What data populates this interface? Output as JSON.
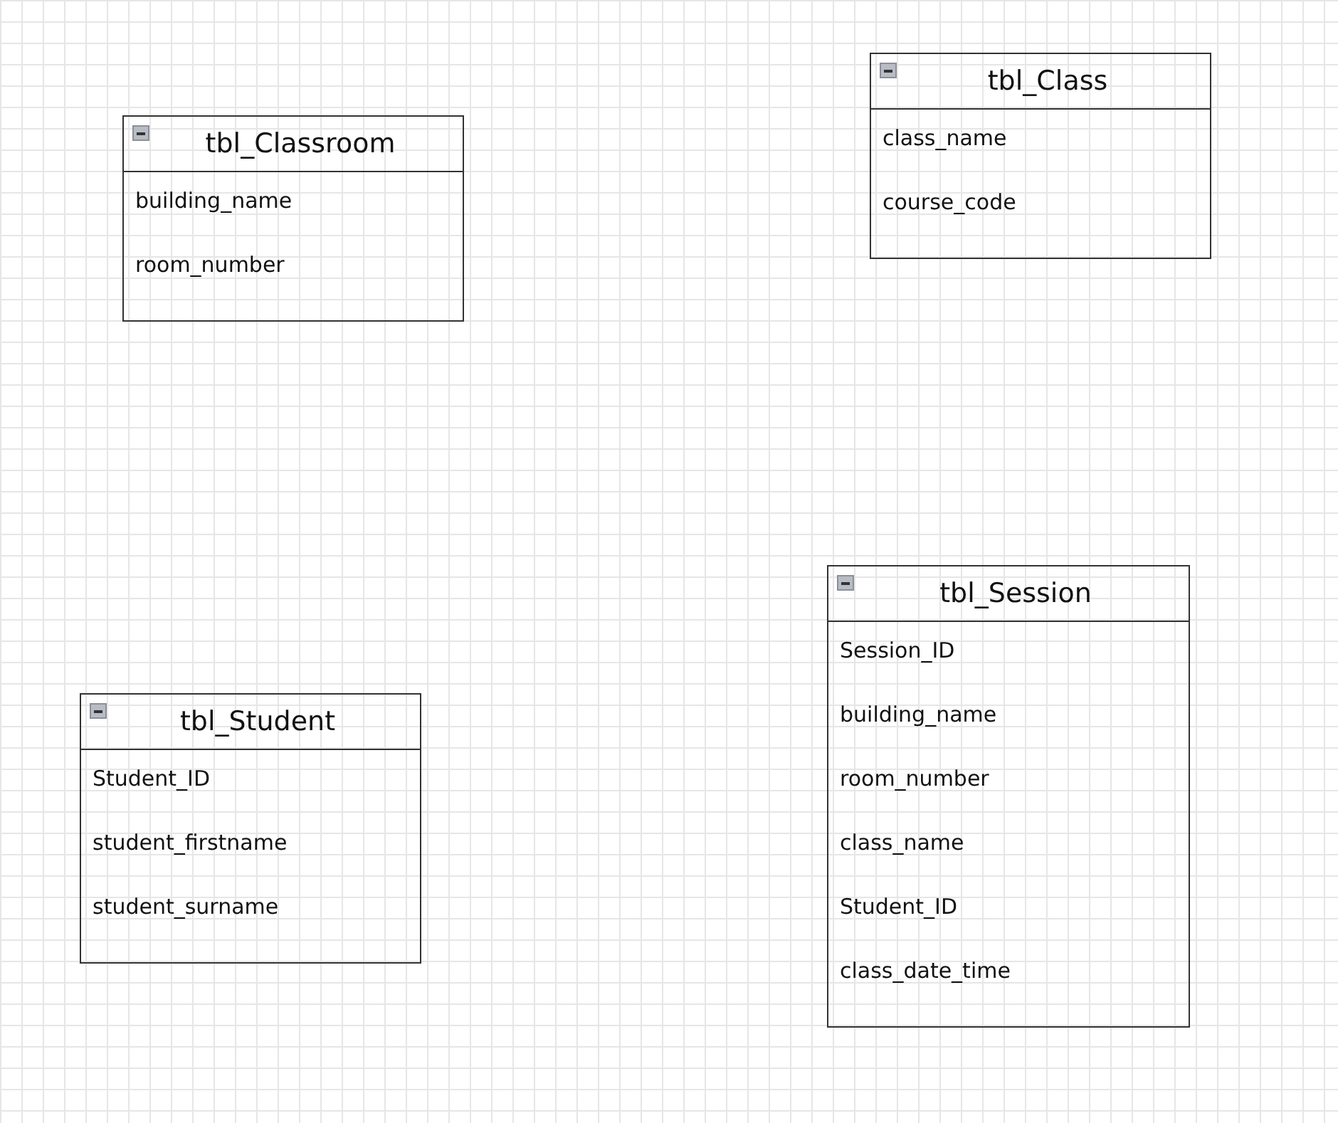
{
  "tables": [
    {
      "name": "tbl_Classroom",
      "collapsed": false,
      "fields": [
        "building_name",
        "room_number"
      ]
    },
    {
      "name": "tbl_Class",
      "collapsed": false,
      "fields": [
        "class_name",
        "course_code"
      ]
    },
    {
      "name": "tbl_Student",
      "collapsed": false,
      "fields": [
        "Student_ID",
        "student_firstname",
        "student_surname"
      ]
    },
    {
      "name": "tbl_Session",
      "collapsed": false,
      "fields": [
        "Session_ID",
        "building_name",
        "room_number",
        "class_name",
        "Student_ID",
        "class_date_time"
      ]
    }
  ]
}
